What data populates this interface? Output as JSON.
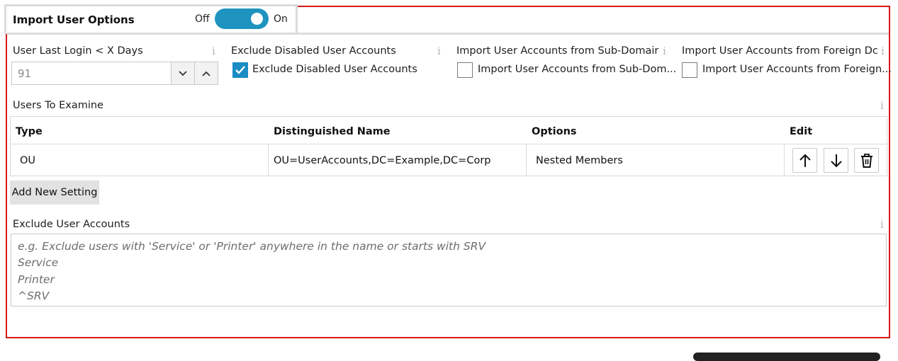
{
  "header": {
    "title": "Import User Options",
    "toggle_off_label": "Off",
    "toggle_on_label": "On",
    "toggle_state": "on"
  },
  "info_icon_glyph": "i",
  "settings": {
    "last_login": {
      "label": "User Last Login < X Days",
      "value": "91"
    },
    "exclude_disabled": {
      "label": "Exclude Disabled User Accounts",
      "checkbox_label": "Exclude Disabled User Accounts",
      "checked": true
    },
    "sub_domain": {
      "label": "Import User Accounts from Sub-Domair",
      "checkbox_label": "Import User Accounts from Sub-Dom...",
      "checked": false
    },
    "foreign_dc": {
      "label": "Import User Accounts from Foreign Dc",
      "checkbox_label": "Import User Accounts from Foreign...",
      "checked": false
    }
  },
  "users_to_examine": {
    "label": "Users To Examine",
    "columns": [
      "Type",
      "Distinguished Name",
      "Options",
      "Edit"
    ],
    "rows": [
      {
        "type": "OU",
        "distinguished_name": "OU=UserAccounts,DC=Example,DC=Corp",
        "options": "Nested Members"
      }
    ],
    "add_button_label": "Add New Setting"
  },
  "exclude_accounts": {
    "label": "Exclude User Accounts",
    "lines": [
      "e.g. Exclude users with 'Service' or 'Printer' anywhere in the name or starts with SRV",
      "Service",
      "Printer",
      "^SRV"
    ]
  },
  "colors": {
    "frame_red": "#d9191c",
    "accent_blue": "#1e93bf",
    "checkbox_blue": "#1b8cc4"
  },
  "icons": [
    "chevron-down-icon",
    "chevron-up-icon",
    "checkmark-icon",
    "arrow-up-icon",
    "arrow-down-icon",
    "trash-icon",
    "info-icon"
  ]
}
